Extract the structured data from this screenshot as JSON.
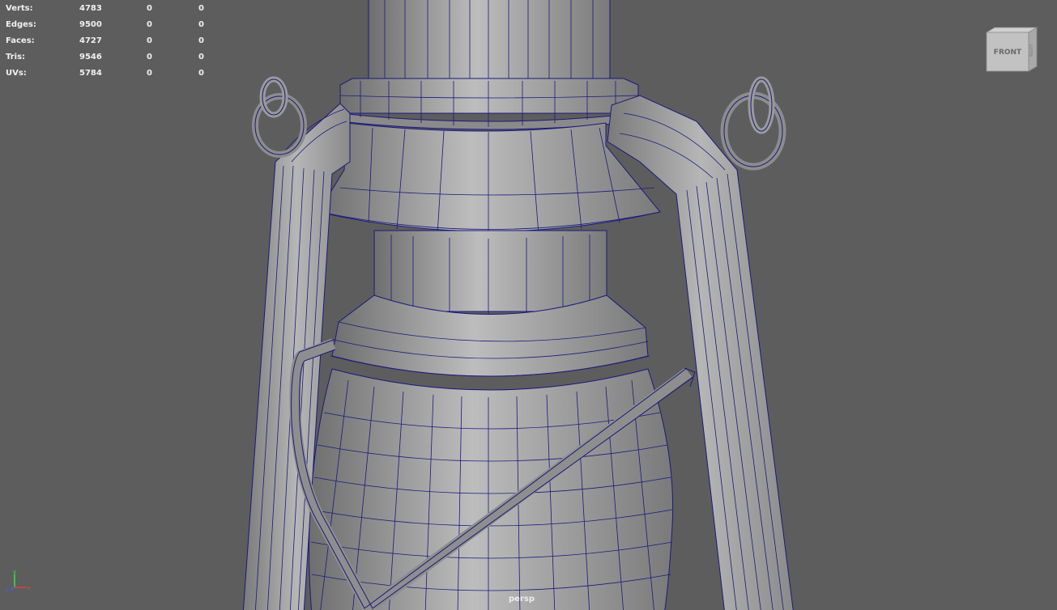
{
  "hud": {
    "rows": [
      {
        "label": "Verts:",
        "total": "4783",
        "selected": "0",
        "extra": "0"
      },
      {
        "label": "Edges:",
        "total": "9500",
        "selected": "0",
        "extra": "0"
      },
      {
        "label": "Faces:",
        "total": "4727",
        "selected": "0",
        "extra": "0"
      },
      {
        "label": "Tris:",
        "total": "9546",
        "selected": "0",
        "extra": "0"
      },
      {
        "label": "UVs:",
        "total": "5784",
        "selected": "0",
        "extra": "0"
      }
    ]
  },
  "viewport": {
    "camera_label": "persp",
    "view_cube": {
      "front_label": "FRONT",
      "side_label": "RIGHT"
    },
    "axes": {
      "x": "x",
      "y": "y",
      "z": "z"
    }
  },
  "colors": {
    "background": "#5d5d5d",
    "wireframe": "#1a1a7e",
    "mesh_light": "#b4b4b4",
    "mesh_dark": "#7a7a7a",
    "axis_x": "#e04040",
    "axis_y": "#40e040",
    "axis_z": "#4060ff"
  }
}
